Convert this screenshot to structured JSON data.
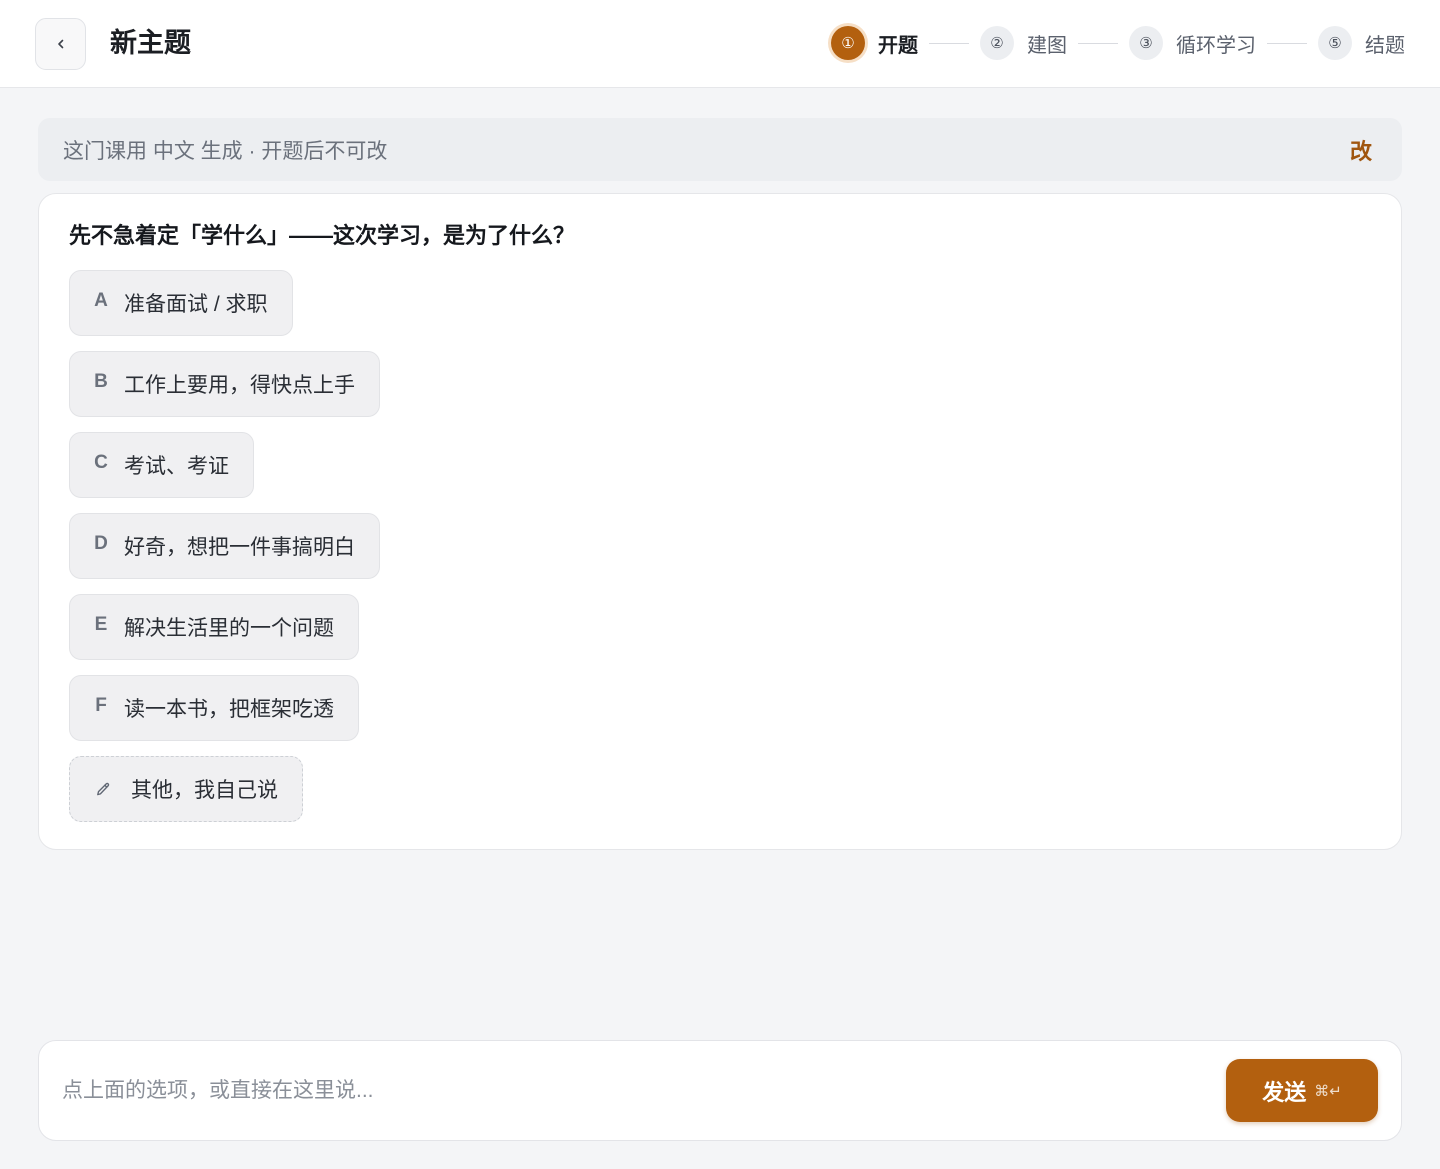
{
  "header": {
    "back_icon": "chevron-left-icon",
    "title": "新主题"
  },
  "stepper": {
    "active_index": 0,
    "steps": [
      {
        "number": "①",
        "label": "开题"
      },
      {
        "number": "②",
        "label": "建图"
      },
      {
        "number": "③",
        "label": "循环学习"
      },
      {
        "number": "⑤",
        "label": "结题"
      }
    ]
  },
  "notice": {
    "text": "这门课用 中文 生成 · 开题后不可改",
    "action_label": "改"
  },
  "question": {
    "prompt": "先不急着定「学什么」——这次学习，是为了什么？",
    "options": [
      {
        "key": "A",
        "label": "准备面试 / 求职"
      },
      {
        "key": "B",
        "label": "工作上要用，得快点上手"
      },
      {
        "key": "C",
        "label": "考试、考证"
      },
      {
        "key": "D",
        "label": "好奇，想把一件事搞明白"
      },
      {
        "key": "E",
        "label": "解决生活里的一个问题"
      },
      {
        "key": "F",
        "label": "读一本书，把框架吃透"
      }
    ],
    "other": {
      "icon": "pencil-icon",
      "label": "其他，我自己说"
    }
  },
  "composer": {
    "value": "",
    "placeholder": "点上面的选项，或直接在这里说...",
    "send_label": "发送",
    "send_shortcut": "⌘↵"
  },
  "colors": {
    "accent": "#b3600f",
    "accent_ring": "#f6dfc6",
    "accent_text": "#a0560f",
    "page_bg": "#f4f5f7",
    "notice_bg": "#eceef1"
  }
}
